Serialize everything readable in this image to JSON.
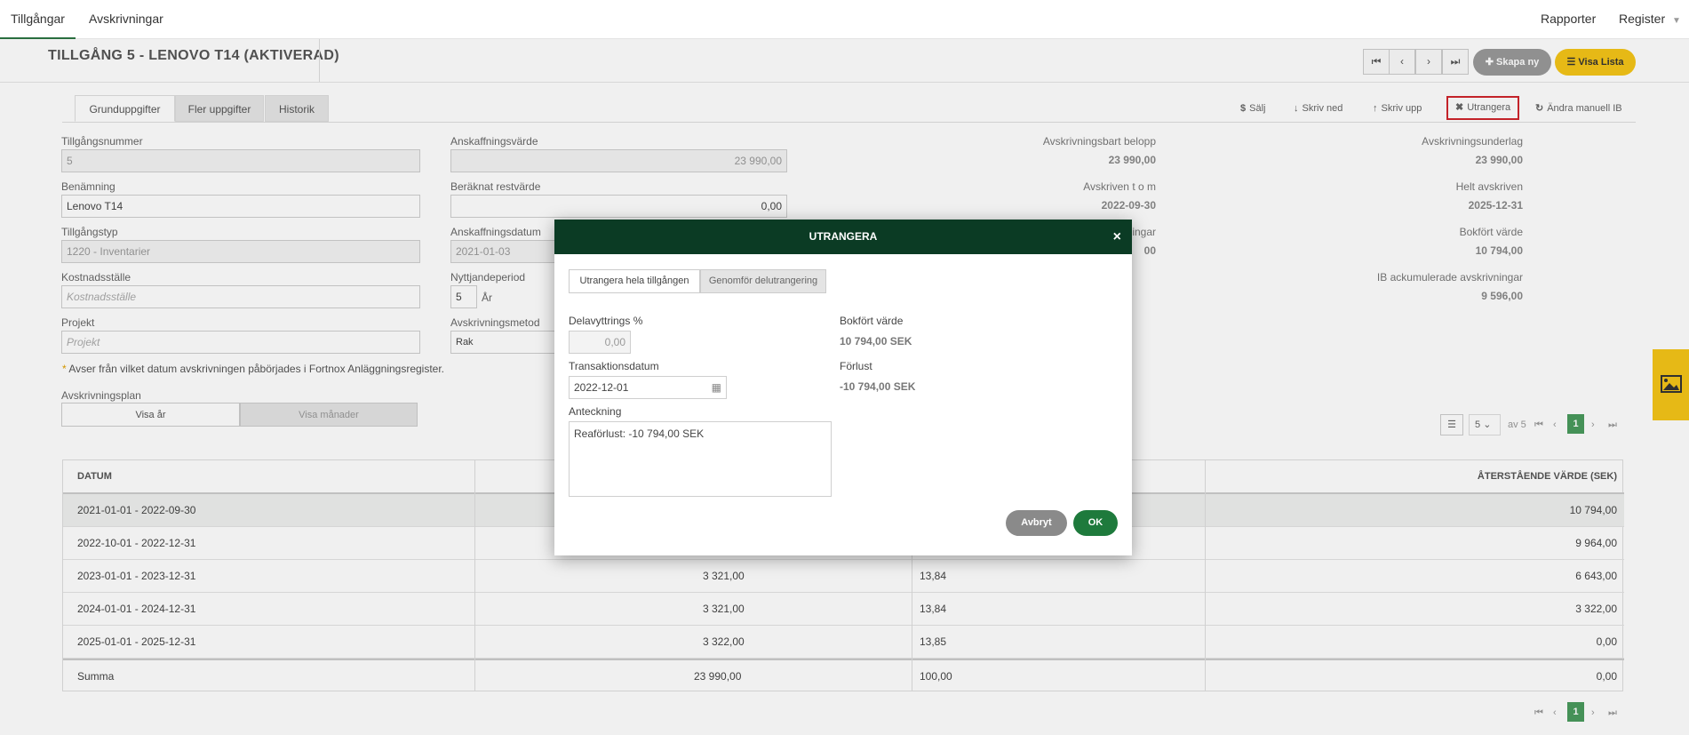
{
  "topnav": {
    "tabs": [
      "Tillgångar",
      "Avskrivningar"
    ],
    "right": [
      "Rapporter",
      "Register"
    ]
  },
  "header": {
    "title": "TILLGÅNG 5 - LENOVO T14 (AKTIVERAD)",
    "create_label": "Skapa ny",
    "list_label": "Visa Lista"
  },
  "subtabs": [
    "Grunduppgifter",
    "Fler uppgifter",
    "Historik"
  ],
  "actions": [
    "Sälj",
    "Skriv ned",
    "Skriv upp",
    "Utrangera",
    "Ändra manuell IB"
  ],
  "form": {
    "asset_number_label": "Tillgångsnummer",
    "asset_number": "5",
    "name_label": "Benämning",
    "name": "Lenovo T14",
    "type_label": "Tillgångstyp",
    "type": "1220 - Inventarier",
    "cost_center_label": "Kostnadsställe",
    "cost_center_placeholder": "Kostnadsställe",
    "project_label": "Projekt",
    "project_placeholder": "Projekt",
    "acq_value_label": "Anskaffningsvärde",
    "acq_value": "23 990,00",
    "residual_label": "Beräknat restvärde",
    "residual": "0,00",
    "acq_date_label": "Anskaffningsdatum",
    "acq_date": "2021-01-03",
    "period_label": "Nyttjandeperiod",
    "period": "5",
    "period_unit": "År",
    "method_label": "Avskrivningsmetod",
    "method": "Rak",
    "note_star": "*",
    "note": "Avser från vilket datum avskrivningen påbörjades i Fortnox Anläggningsregister.",
    "plan_label": "Avskrivningsplan",
    "plan_years": "Visa år",
    "plan_months": "Visa månader"
  },
  "summary": {
    "depr_amount_label": "Avskrivningsbart belopp",
    "depr_amount": "23 990,00",
    "depr_until_label": "Avskriven t o m",
    "depr_until": "2022-09-30",
    "depr_acc_label_partial": "ingar",
    "depr_acc_partial": "00",
    "basis_label": "Avskrivningsunderlag",
    "basis": "23 990,00",
    "fully_label": "Helt avskriven",
    "fully": "2025-12-31",
    "book_label": "Bokfört värde",
    "book": "10 794,00",
    "ib_label": "IB ackumulerade avskrivningar",
    "ib": "9 596,00"
  },
  "pager_top": {
    "page_size": "5",
    "of": "av 5",
    "page": "1"
  },
  "table": {
    "headers": [
      "DATUM",
      "",
      "",
      "ÅTERSTÅENDE VÄRDE (SEK)"
    ],
    "rows": [
      {
        "date": "2021-01-01 - 2022-09-30",
        "amount": "",
        "pct": "",
        "remaining": "10 794,00"
      },
      {
        "date": "2022-10-01 - 2022-12-31",
        "amount": "",
        "pct": "",
        "remaining": "9 964,00"
      },
      {
        "date": "2023-01-01 - 2023-12-31",
        "amount": "3 321,00",
        "pct": "13,84",
        "remaining": "6 643,00"
      },
      {
        "date": "2024-01-01 - 2024-12-31",
        "amount": "3 321,00",
        "pct": "13,84",
        "remaining": "3 322,00"
      },
      {
        "date": "2025-01-01 - 2025-12-31",
        "amount": "3 322,00",
        "pct": "13,85",
        "remaining": "0,00"
      }
    ],
    "sum": {
      "label": "Summa",
      "amount": "23 990,00",
      "pct": "100,00",
      "remaining": "0,00"
    }
  },
  "pager_bottom": {
    "page": "1"
  },
  "modal": {
    "title": "UTRANGERA",
    "close": "×",
    "tabs": [
      "Utrangera hela tillgången",
      "Genomför delutrangering"
    ],
    "partial_label": "Delavyttrings %",
    "partial_value": "0,00",
    "date_label": "Transaktionsdatum",
    "date_value": "2022-12-01",
    "note_label": "Anteckning",
    "note_value": "Reaförlust: -10 794,00 SEK",
    "book_label": "Bokfört värde",
    "book_value": "10 794,00 SEK",
    "loss_label": "Förlust",
    "loss_value": "-10 794,00 SEK",
    "cancel": "Avbryt",
    "ok": "OK"
  },
  "colors": {
    "modal_header": "#0b3b24",
    "ok_button": "#1e7a3c",
    "accent_yellow": "#f5c518",
    "highlight_red": "#d0252c"
  }
}
